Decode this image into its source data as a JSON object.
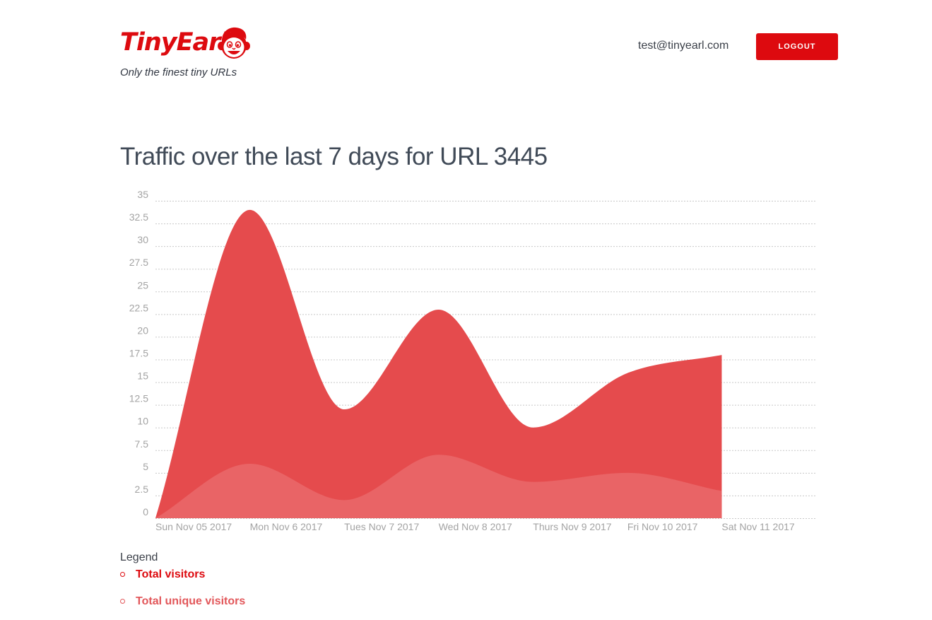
{
  "header": {
    "logo_text": "TinyEarl",
    "tagline": "Only the finest tiny URLs",
    "user_email": "test@tinyearl.com",
    "logout_label": "LOGOUT",
    "logo_icon": "cartoon-face-icon"
  },
  "colors": {
    "brand": "#dd0a0f",
    "total_area": "#e54b4d",
    "unique_area": "#e96466",
    "unique_text": "#e2575a",
    "grid": "#c8c8c8",
    "tick_text": "#a3a3a3"
  },
  "page": {
    "title": "Traffic over the last 7 days for URL 3445"
  },
  "chart_data": {
    "type": "area",
    "x": [
      "Sun Nov 05 2017",
      "Mon Nov 6 2017",
      "Tues Nov 7 2017",
      "Wed Nov 8 2017",
      "Thurs Nov 9 2017",
      "Fri Nov 10 2017",
      "Sat Nov 11 2017"
    ],
    "series": [
      {
        "name": "Total visitors",
        "values": [
          0,
          34,
          12,
          23,
          10,
          16,
          18
        ]
      },
      {
        "name": "Total unique visitors",
        "values": [
          0,
          6,
          2,
          7,
          4,
          5,
          3
        ]
      }
    ],
    "yticks": [
      "0",
      "2.5",
      "5",
      "7.5",
      "10",
      "12.5",
      "15",
      "17.5",
      "20",
      "22.5",
      "25",
      "27.5",
      "30",
      "32.5",
      "35"
    ],
    "ylim": [
      0,
      35
    ],
    "grid": true,
    "curve": "smooth"
  },
  "legend": {
    "title": "Legend",
    "items": [
      "Total visitors",
      "Total unique visitors"
    ]
  }
}
